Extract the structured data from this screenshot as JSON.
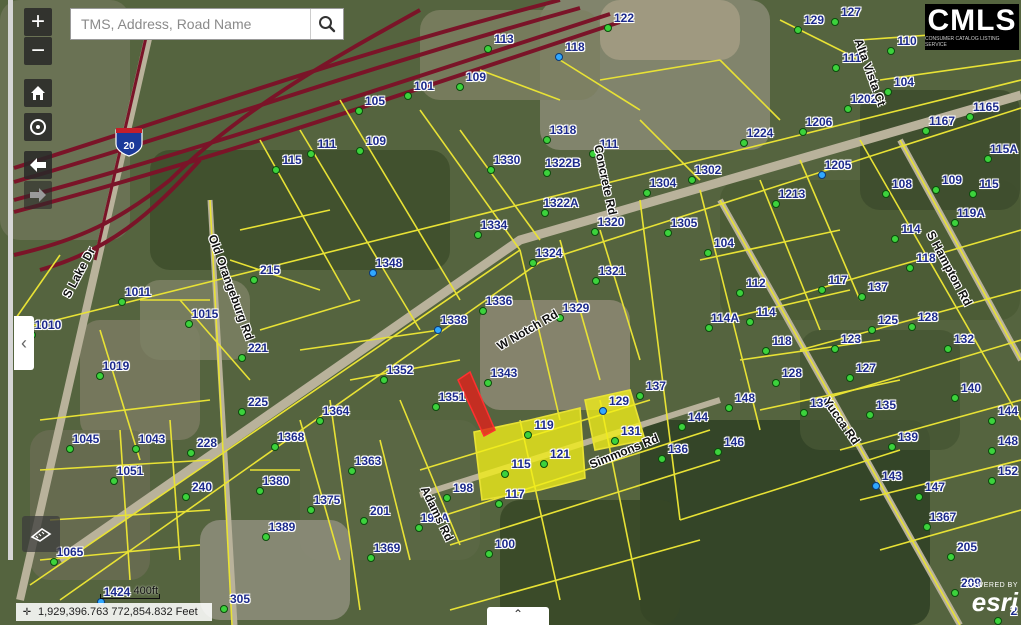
{
  "search": {
    "placeholder": "TMS, Address, Road Name"
  },
  "logo": {
    "brand": "CMLS",
    "tagline": "CONSUMER CATALOG LISTING SERVICE"
  },
  "zoom": {
    "in_label": "+",
    "out_label": "−"
  },
  "coordinates": "1,929,396.763 772,854.832 Feet",
  "scale": "400ft",
  "attribution": {
    "powered": "POWERED BY",
    "name": "esri"
  },
  "interstate": "20",
  "colors": {
    "parcel_line": "#e8e235",
    "highway": "#7a1428",
    "selected_fill": "#f2ee18",
    "selected_red": "#e0201c",
    "label": "#1c2a8c"
  },
  "roads": [
    {
      "name": "S Lake Dr"
    },
    {
      "name": "Old Orangeburg Rd"
    },
    {
      "name": "W Notch Rd"
    },
    {
      "name": "Concrete Rd"
    },
    {
      "name": "Alta Vista Ct"
    },
    {
      "name": "S Hampton Rd"
    },
    {
      "name": "Yucca Rd"
    },
    {
      "name": "Simmons Rd"
    },
    {
      "name": "Adams Rd"
    }
  ],
  "parcels": [
    "122",
    "129",
    "127",
    "110",
    "113",
    "118",
    "109",
    "101",
    "111",
    "104",
    "105",
    "1202",
    "1165",
    "1224",
    "1167",
    "1206",
    "1318",
    "115",
    "111",
    "109",
    "1322B",
    "1330",
    "1205",
    "111",
    "1304",
    "1302",
    "108",
    "109",
    "115",
    "115A",
    "1322A",
    "1320",
    "1213",
    "119A",
    "1334",
    "1305",
    "104",
    "114",
    "1324",
    "1348",
    "215",
    "1321",
    "117",
    "118",
    "1011",
    "137",
    "1336",
    "1329",
    "112",
    "114A",
    "114",
    "125",
    "128",
    "1010",
    "1015",
    "221",
    "1338",
    "118",
    "123",
    "132",
    "1352",
    "1343",
    "127",
    "1019",
    "128",
    "140",
    "1351",
    "137",
    "148",
    "130",
    "135",
    "225",
    "1364",
    "129",
    "144",
    "144",
    "1368",
    "119",
    "131",
    "139",
    "148",
    "1045",
    "1043",
    "228",
    "136",
    "146",
    "121",
    "1051",
    "1363",
    "115",
    "143",
    "152",
    "198",
    "240",
    "1380",
    "117",
    "147",
    "1375",
    "201",
    "1367",
    "192A",
    "1389",
    "1065",
    "100",
    "1369",
    "205",
    "209",
    "1424",
    "305",
    "2"
  ]
}
